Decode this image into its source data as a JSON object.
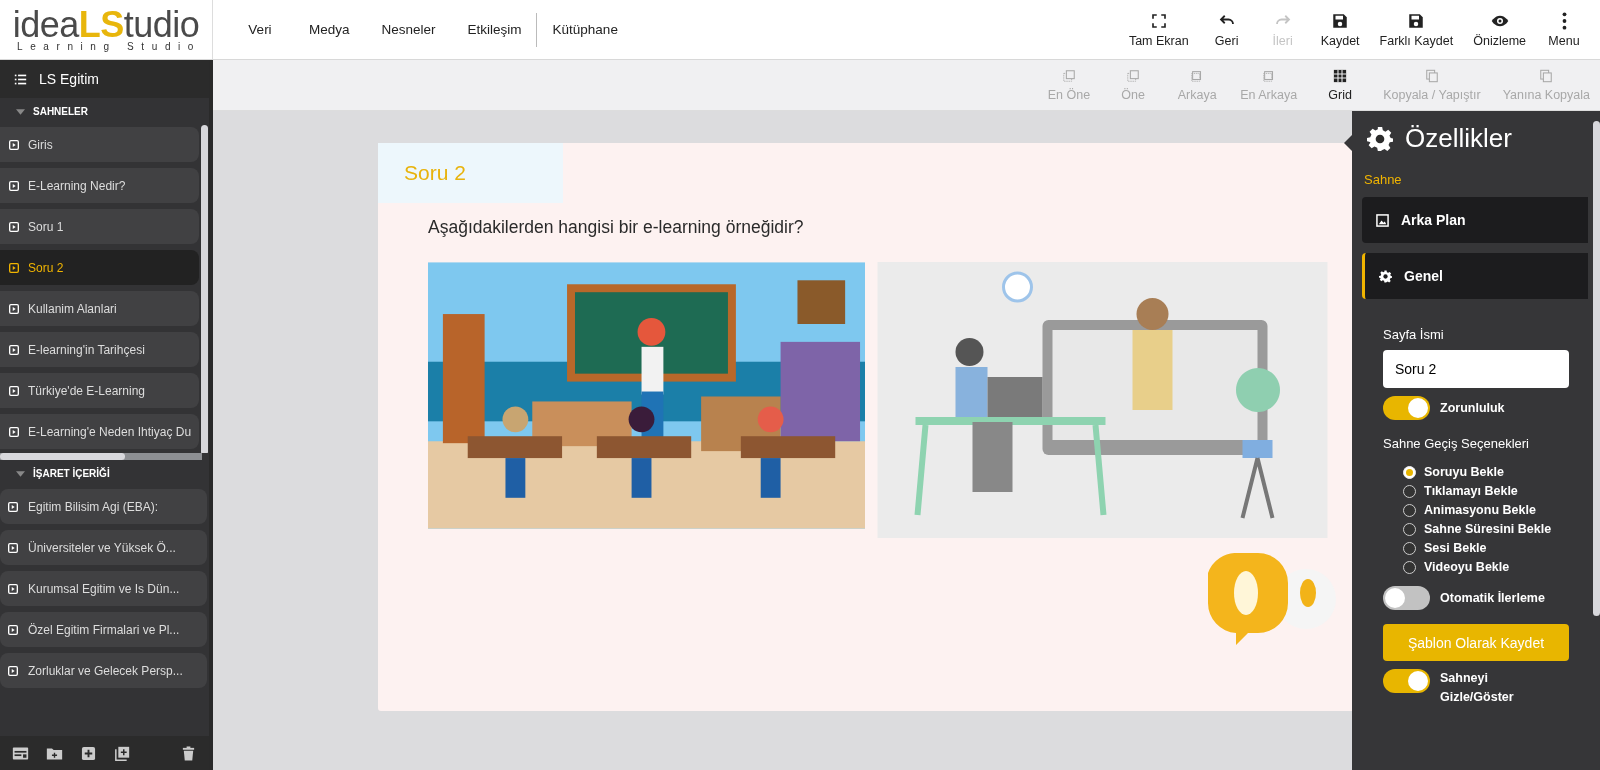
{
  "logo": {
    "word_start": "idea",
    "word_accent": "LS",
    "word_end": "tudio",
    "tagline": "Learning Studio"
  },
  "nav_menu": [
    {
      "label": "Veri"
    },
    {
      "label": "Medya"
    },
    {
      "label": "Nesneler"
    },
    {
      "label": "Etkileşim"
    },
    {
      "label": "Kütüphane"
    }
  ],
  "toolbar": [
    {
      "label": "Tam Ekran",
      "disabled": false
    },
    {
      "label": "Geri",
      "disabled": false
    },
    {
      "label": "İleri",
      "disabled": true
    },
    {
      "label": "Kaydet",
      "disabled": false
    },
    {
      "label": "Farklı Kaydet",
      "disabled": false
    },
    {
      "label": "Önizleme",
      "disabled": false
    },
    {
      "label": "Menu",
      "disabled": false
    }
  ],
  "arrange_toolbar": [
    {
      "label": "En Öne",
      "disabled": true
    },
    {
      "label": "Öne",
      "disabled": true
    },
    {
      "label": "Arkaya",
      "disabled": true
    },
    {
      "label": "En Arkaya",
      "disabled": true
    },
    {
      "label": "Grid",
      "disabled": false
    },
    {
      "label": "Kopyala / Yapıştır",
      "disabled": true
    },
    {
      "label": "Yanına Kopyala",
      "disabled": true
    }
  ],
  "sidebar": {
    "project_title": "LS Egitim",
    "sections": [
      {
        "title": "SAHNELER",
        "expanded": true,
        "items": [
          {
            "label": "Giris",
            "selected": false
          },
          {
            "label": "E-Learning Nedir?",
            "selected": false
          },
          {
            "label": "Soru 1",
            "selected": false
          },
          {
            "label": "Soru 2",
            "selected": true
          },
          {
            "label": "Kullanim Alanlari",
            "selected": false
          },
          {
            "label": "E-learning'in Tarihçesi",
            "selected": false
          },
          {
            "label": "Türkiye'de E-Learning",
            "selected": false
          },
          {
            "label": "E-Learning'e Neden Ihtiyaç Du",
            "selected": false
          }
        ]
      },
      {
        "title": "İŞARET İÇERİĞİ",
        "expanded": true,
        "items": [
          {
            "label": "Egitim Bilisim Agi (EBA):",
            "selected": false
          },
          {
            "label": "Üniversiteler ve Yüksek Ö...",
            "selected": false
          },
          {
            "label": "Kurumsal Egitim ve Is Dün...",
            "selected": false
          },
          {
            "label": "Özel Egitim Firmalari ve Pl...",
            "selected": false
          },
          {
            "label": "Zorluklar ve Gelecek Persp...",
            "selected": false
          }
        ]
      }
    ]
  },
  "slide": {
    "title": "Soru 2",
    "question": "Aşağıdakilerden hangisi bir e-learning örneğidir?"
  },
  "properties": {
    "title": "Özellikler",
    "section": "Sahne",
    "panels": [
      {
        "label": "Arka Plan",
        "expanded": false
      },
      {
        "label": "Genel",
        "expanded": true
      }
    ],
    "page_name": {
      "label": "Sayfa İsmi",
      "value": "Soru 2"
    },
    "required_toggle": {
      "label": "Zorunluluk",
      "on": true
    },
    "transition": {
      "label": "Sahne Geçiş Seçenekleri",
      "options": [
        {
          "label": "Soruyu Bekle",
          "selected": true
        },
        {
          "label": "Tıklamayı Bekle",
          "selected": false
        },
        {
          "label": "Animasyonu Bekle",
          "selected": false
        },
        {
          "label": "Sahne Süresini Bekle",
          "selected": false
        },
        {
          "label": "Sesi Bekle",
          "selected": false
        },
        {
          "label": "Videoyu Bekle",
          "selected": false
        }
      ]
    },
    "auto_advance_toggle": {
      "label": "Otomatik İlerleme",
      "on": false
    },
    "save_template_button": "Şablon Olarak Kaydet",
    "visibility_toggle": {
      "label": "Sahneyi Gizle/Göster",
      "on": true
    }
  }
}
